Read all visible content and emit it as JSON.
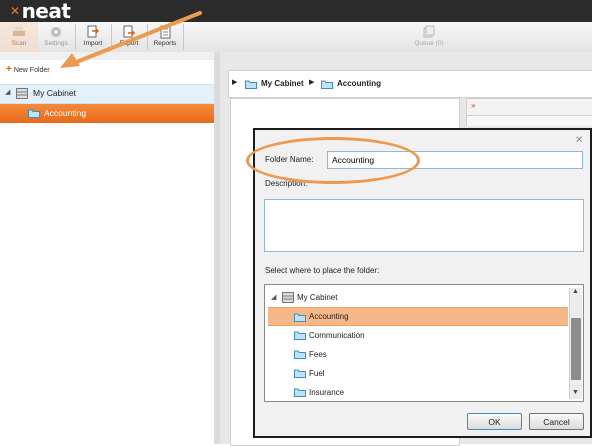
{
  "app": {
    "logo_text": "neat"
  },
  "toolbar": {
    "scan": "Scan",
    "settings": "Settings",
    "import": "Import",
    "export": "Export",
    "reports": "Reports",
    "queue": "Queue (0)"
  },
  "sidebar": {
    "new_folder": "New Folder",
    "items": [
      {
        "label": "My Cabinet"
      },
      {
        "label": "Accounting"
      }
    ]
  },
  "breadcrumb": {
    "root": "My Cabinet",
    "current": "Accounting"
  },
  "dialog": {
    "folder_name_label": "Folder Name:",
    "folder_name_value": "Accounting",
    "description_label": "Description:",
    "place_label": "Select where to place the folder:",
    "tree_root": "My Cabinet",
    "tree_items": [
      {
        "label": "Accounting",
        "selected": true
      },
      {
        "label": "Communication"
      },
      {
        "label": "Fees"
      },
      {
        "label": "Fuel"
      },
      {
        "label": "Insurance"
      }
    ],
    "ok_label": "OK",
    "cancel_label": "Cancel"
  },
  "colors": {
    "accent_orange": "#e8691b",
    "annotation_orange": "#ec9a4e",
    "selection_blue": "#e4f1fa"
  }
}
